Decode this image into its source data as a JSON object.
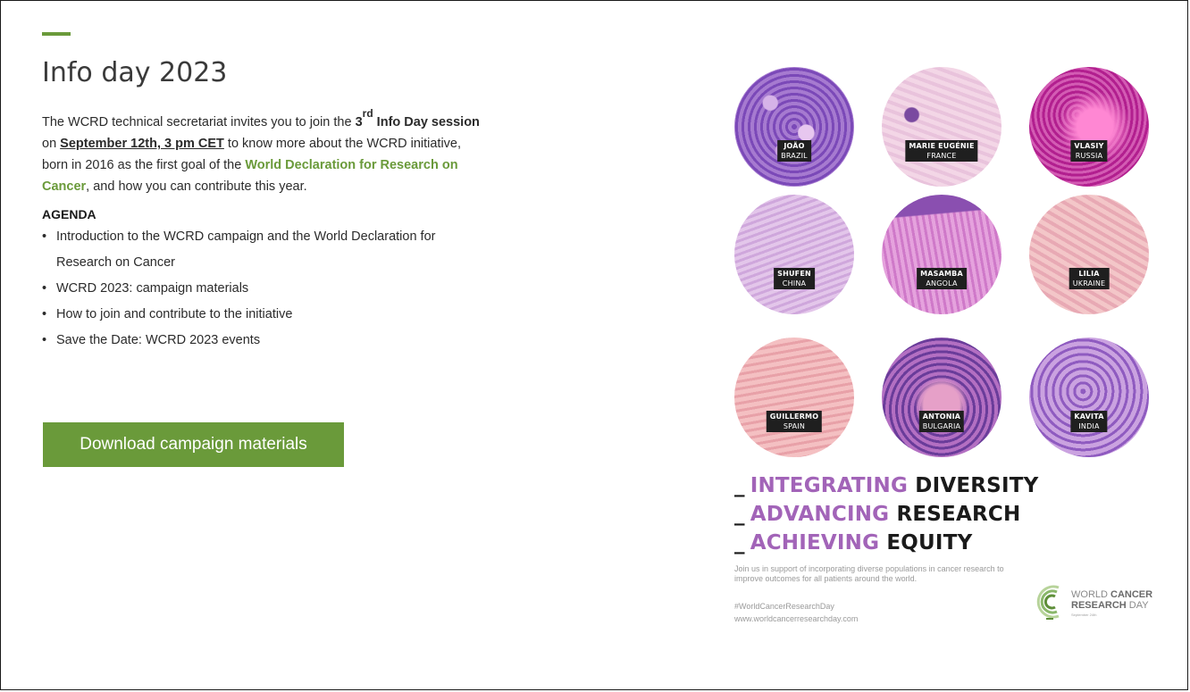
{
  "page": {
    "title": "Info day 2023",
    "accent_color": "#6a9a3a"
  },
  "intro": {
    "part1": "The WCRD technical secretariat invites you to join the ",
    "ordinal_number": "3",
    "ordinal_suffix": "rd",
    "bold1": " Info Day session",
    "part2": " on ",
    "date_link": "September 12th, 3 pm CET",
    "part3": " to know more about the WCRD initiative, born in 2016 as the first goal of the ",
    "declaration_link": "World Declaration for Research on Cancer",
    "part4": ", and how you can contribute this year."
  },
  "agenda": {
    "title": "AGENDA",
    "items": [
      "Introduction to the WCRD campaign and the World Declaration for Research on Cancer",
      "WCRD 2023: campaign materials",
      "How to join and contribute to the initiative",
      "Save the Date: WCRD 2023 events"
    ]
  },
  "download_button": {
    "label": "Download campaign materials"
  },
  "poster": {
    "people": [
      {
        "name": "JOÃO",
        "country": "BRAZIL"
      },
      {
        "name": "MARIE EUGÉNIE",
        "country": "FRANCE"
      },
      {
        "name": "VLASIY",
        "country": "RUSSIA"
      },
      {
        "name": "SHUFEN",
        "country": "CHINA"
      },
      {
        "name": "MASAMBA",
        "country": "ANGOLA"
      },
      {
        "name": "LILIA",
        "country": "UKRAINE"
      },
      {
        "name": "GUILLERMO",
        "country": "SPAIN"
      },
      {
        "name": "ANTONIA",
        "country": "BULGARIA"
      },
      {
        "name": "KAVITA",
        "country": "INDIA"
      }
    ],
    "slogans": [
      {
        "dash": "_",
        "highlight": "INTEGRATING",
        "rest": " DIVERSITY"
      },
      {
        "dash": "_",
        "highlight": "ADVANCING",
        "rest": " RESEARCH"
      },
      {
        "dash": "_",
        "highlight": "ACHIEVING",
        "rest": " EQUITY"
      }
    ],
    "support_text": "Join us in support of incorporating diverse populations in cancer research to improve outcomes for all patients around the world.",
    "hashtag": "#WorldCancerResearchDay",
    "website": "www.worldcancerresearchday.com",
    "logo_line1_light": "WORLD ",
    "logo_line1_bold": "CANCER",
    "logo_line2_bold": "RESEARCH",
    "logo_line2_light": " DAY",
    "logo_sub": "September 24th",
    "highlight_color": "#a264b8"
  }
}
